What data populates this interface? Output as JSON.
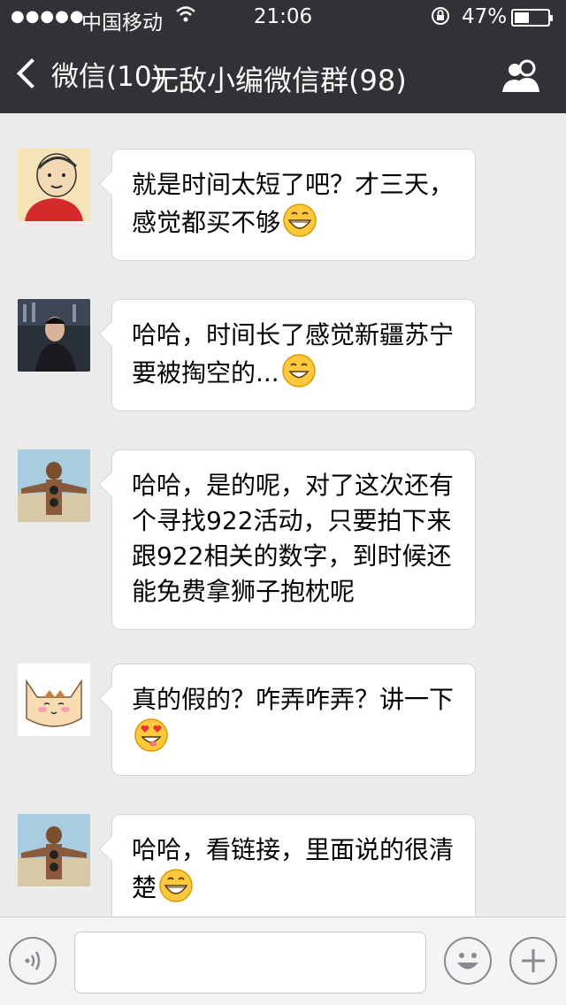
{
  "status_bar": {
    "signal": "●●●●●",
    "carrier": "中国移动",
    "time": "21:06",
    "battery_percent": "47%"
  },
  "nav": {
    "back_label": "微信(10)",
    "title": "无敌小编微信群(98)"
  },
  "messages": [
    {
      "text": "就是时间太短了吧？才三天，感觉都买不够",
      "emoji": "grinning-emoji"
    },
    {
      "text": "哈哈，时间长了感觉新疆苏宁要被掏空的...",
      "emoji": "smiling-emoji"
    },
    {
      "text": "哈哈，是的呢，对了这次还有个寻找922活动，只要拍下来跟922相关的数字，到时候还能免费拿狮子抱枕呢",
      "emoji": ""
    },
    {
      "text": "真的假的？咋弄咋弄？讲一下",
      "emoji": "heart-eyes-emoji"
    },
    {
      "text": "哈哈，看链接，里面说的很清楚",
      "emoji": "grinning-emoji"
    }
  ],
  "input": {
    "value": "",
    "placeholder": ""
  },
  "icons": {
    "voice": "voice-icon",
    "emoji": "emoji-icon",
    "plus": "plus-icon",
    "members": "members-icon"
  }
}
